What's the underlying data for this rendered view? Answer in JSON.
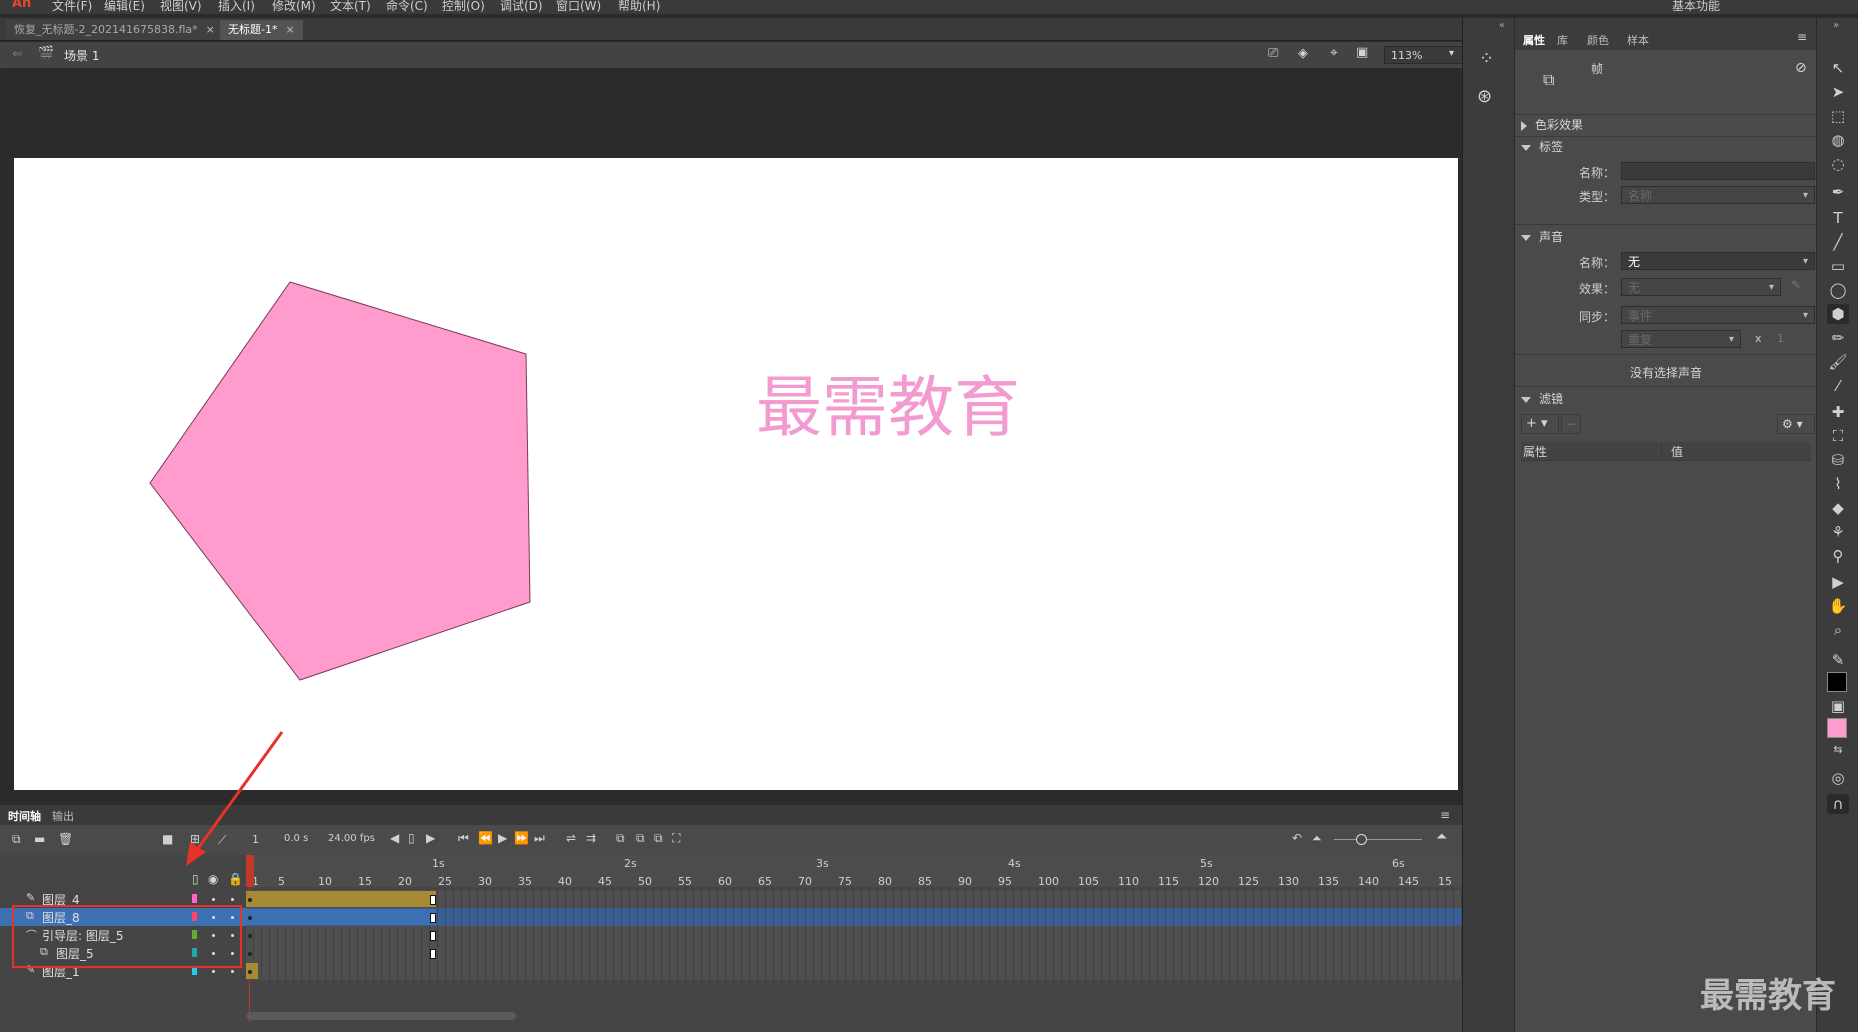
{
  "menubar": {
    "logo": "An",
    "items": [
      "文件(F)",
      "编辑(E)",
      "视图(V)",
      "插入(I)",
      "修改(M)",
      "文本(T)",
      "命令(C)",
      "控制(O)",
      "调试(D)",
      "窗口(W)",
      "帮助(H)"
    ],
    "workspace": "基本功能"
  },
  "doc_tabs": [
    {
      "label": "恢复_无标题-2_202141675838.fla*",
      "active": false
    },
    {
      "label": "无标题-1*",
      "active": true
    }
  ],
  "editbar": {
    "scene": "场景 1",
    "zoom": "113%"
  },
  "stage": {
    "text": "最需教育",
    "text_color": "#f39ad0",
    "shape_fill": "#ff9ccd"
  },
  "properties_panel": {
    "tabs": [
      "属性",
      "库",
      "颜色",
      "样本"
    ],
    "type_label": "帧",
    "sections": {
      "color_effect": "色彩效果",
      "label": "标签",
      "sound": "声音",
      "filters": "滤镜"
    },
    "label_fields": {
      "name_label": "名称：",
      "type_label": "类型：",
      "type_value": "名称"
    },
    "sound_fields": {
      "name_label": "名称：",
      "name_value": "无",
      "effect_label": "效果：",
      "effect_value": "无",
      "sync_label": "同步：",
      "sync_value": "事件",
      "repeat_value": "重复",
      "times_x": "x",
      "times_value": "1",
      "none_selected": "没有选择声音"
    },
    "filter_cols": [
      "属性",
      "值"
    ]
  },
  "timeline": {
    "tabs": [
      "时间轴",
      "输出"
    ],
    "current_frame": "1",
    "time": "0.0 s",
    "fps": "24.00 fps",
    "seconds": [
      "1s",
      "2s",
      "3s",
      "4s",
      "5s",
      "6s"
    ],
    "frame_ticks": [
      "1",
      "5",
      "10",
      "15",
      "20",
      "25",
      "30",
      "35",
      "40",
      "45",
      "50",
      "55",
      "60",
      "65",
      "70",
      "75",
      "80",
      "85",
      "90",
      "95",
      "100",
      "105",
      "110",
      "115",
      "120",
      "125",
      "130",
      "135",
      "140",
      "145",
      "15"
    ],
    "layers": [
      {
        "name": "图层_4",
        "color": "#ff66cc",
        "selected": false,
        "tween": "#a68a36"
      },
      {
        "name": "图层_8",
        "color": "#ff4466",
        "selected": true,
        "tween": "#3d6fb3"
      },
      {
        "name": "引导层: 图层_5",
        "color": "#66aa33",
        "selected": false,
        "tween": ""
      },
      {
        "name": "图层_5",
        "color": "#22aaaa",
        "selected": false,
        "tween": ""
      },
      {
        "name": "图层_1",
        "color": "#22ccee",
        "selected": false,
        "tween": "#a68a36"
      }
    ]
  },
  "watermark": "最需教育"
}
